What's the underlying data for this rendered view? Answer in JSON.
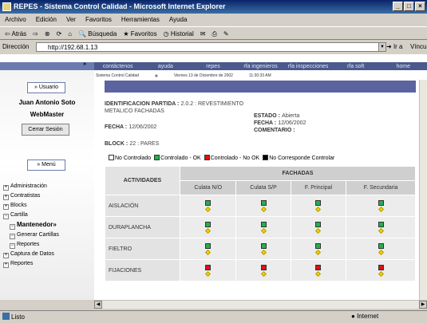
{
  "window": {
    "title": "REPES - Sistema Control Calidad - Microsoft Internet Explorer"
  },
  "menu": [
    "Archivo",
    "Edición",
    "Ver",
    "Favoritos",
    "Herramientas",
    "Ayuda"
  ],
  "toolbar": {
    "back": "⇦ Atrás",
    "search": "Búsqueda",
    "favorites": "Favoritos",
    "history": "Historial"
  },
  "address": {
    "label": "Dirección",
    "value": "http://192.68.1.13",
    "go": "Ir a",
    "links": "Vínculos"
  },
  "site_nav": [
    "contáctenos",
    "ayuda",
    "repes",
    "rfa ingenieros",
    "rfa inspecciones",
    "rfa soft",
    "home"
  ],
  "crumb": {
    "app": "Sistema Control Calidad",
    "date": "Viernes 13 de Diciembre de 2002",
    "time": "11:30:33 AM",
    "sep": "»"
  },
  "sidebar": {
    "user_button": "Usuario",
    "name": "Juan Antonio Soto",
    "role": "WebMaster",
    "logout": "Cerrar Sesión",
    "menu_button": "Menú",
    "tree": [
      {
        "label": "Administración",
        "sign": "+",
        "indent": 0,
        "bold": false
      },
      {
        "label": "Contratistas",
        "sign": "+",
        "indent": 0,
        "bold": false
      },
      {
        "label": "Blocks",
        "sign": "+",
        "indent": 0,
        "bold": false
      },
      {
        "label": "Cartilla",
        "sign": "−",
        "indent": 0,
        "bold": false
      },
      {
        "label": "Mantenedor»",
        "sign": "−",
        "indent": 1,
        "bold": true
      },
      {
        "label": "Generar Cartillas",
        "sign": "−",
        "indent": 1,
        "bold": false
      },
      {
        "label": "Reportes",
        "sign": "−",
        "indent": 1,
        "bold": false
      },
      {
        "label": "Captura de Datos",
        "sign": "+",
        "indent": 0,
        "bold": false
      },
      {
        "label": "Reportes",
        "sign": "+",
        "indent": 0,
        "bold": false
      }
    ]
  },
  "detail": {
    "partida_label": "IDENTIFICACION PARTIDA :",
    "partida_value": "2.0.2 : REVESTIMIENTO",
    "partida_sub": "METALICO FACHADAS",
    "fecha_label": "FECHA :",
    "fecha_value": "12/06/2002",
    "block_label": "BLOCK :",
    "block_value": "22 : PARES",
    "estado_label": "ESTADO :",
    "estado_value": "Abierta",
    "fecha2_label": "FECHA :",
    "fecha2_value": "12/06/2002",
    "comentario_label": "COMENTARIO :"
  },
  "legend": [
    {
      "label": "No Controlado",
      "color": "#ffffff"
    },
    {
      "label": "Controlado - OK",
      "color": "#22b14c"
    },
    {
      "label": "Controlado - No OK",
      "color": "#e01010"
    },
    {
      "label": "No Corresponde Controlar",
      "color": "#000000"
    }
  ],
  "table": {
    "group_header": "FACHADAS",
    "activities_header": "ACTIVIDADES",
    "columns": [
      "Culata N/O",
      "Culata S/P",
      "F. Principal",
      "F. Secundaria"
    ],
    "rows": [
      {
        "label": "AISLACIÓN",
        "states": [
          "green",
          "green",
          "green",
          "green"
        ]
      },
      {
        "label": "DURAPLANCHA",
        "states": [
          "green",
          "green",
          "green",
          "green"
        ]
      },
      {
        "label": "FIELTRO",
        "states": [
          "green",
          "green",
          "green",
          "green"
        ]
      },
      {
        "label": "FIJACIONES",
        "states": [
          "red",
          "red",
          "red",
          "red"
        ]
      }
    ]
  },
  "colors": {
    "green": "#22b14c",
    "red": "#e01010"
  },
  "status": {
    "text": "Listo",
    "zone": "Internet"
  }
}
